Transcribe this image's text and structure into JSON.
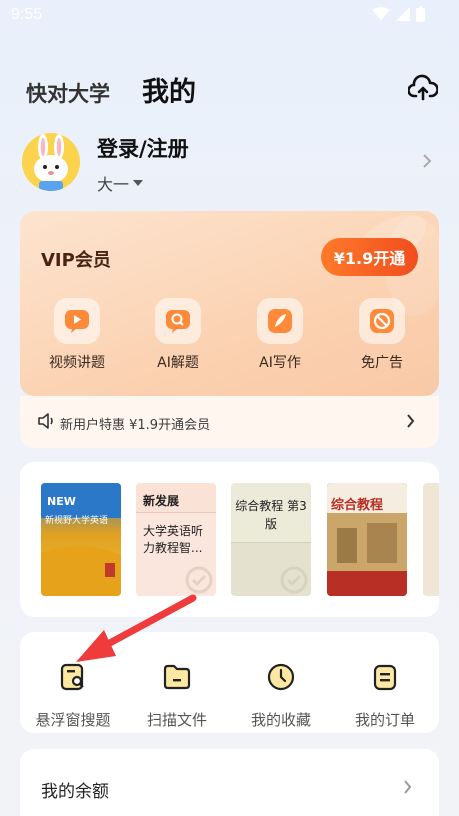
{
  "status_bar": {
    "time": "9:55"
  },
  "tabs": {
    "inactive": "快对大学",
    "active": "我的"
  },
  "profile": {
    "login_label": "登录/注册",
    "grade": "大一"
  },
  "vip": {
    "title": "VIP会员",
    "button": "¥1.9开通",
    "features": [
      "视频讲题",
      "AI解题",
      "AI写作",
      "免广告"
    ],
    "promo": "新用户特惠 ¥1.9开通会员"
  },
  "books": [
    {
      "title": ""
    },
    {
      "title": "新发展",
      "subtitle": "大学英语听力教程智..."
    },
    {
      "title": "综合教程 第3版"
    },
    {
      "title": ""
    },
    {
      "title": ""
    }
  ],
  "tools": [
    "悬浮窗搜题",
    "扫描文件",
    "我的收藏",
    "我的订单"
  ],
  "balance": {
    "label": "我的余额"
  },
  "colors": {
    "accent": "#f14d1e",
    "vip_bg": "#fbd2b2",
    "annotation_arrow": "#ef3b3b"
  }
}
